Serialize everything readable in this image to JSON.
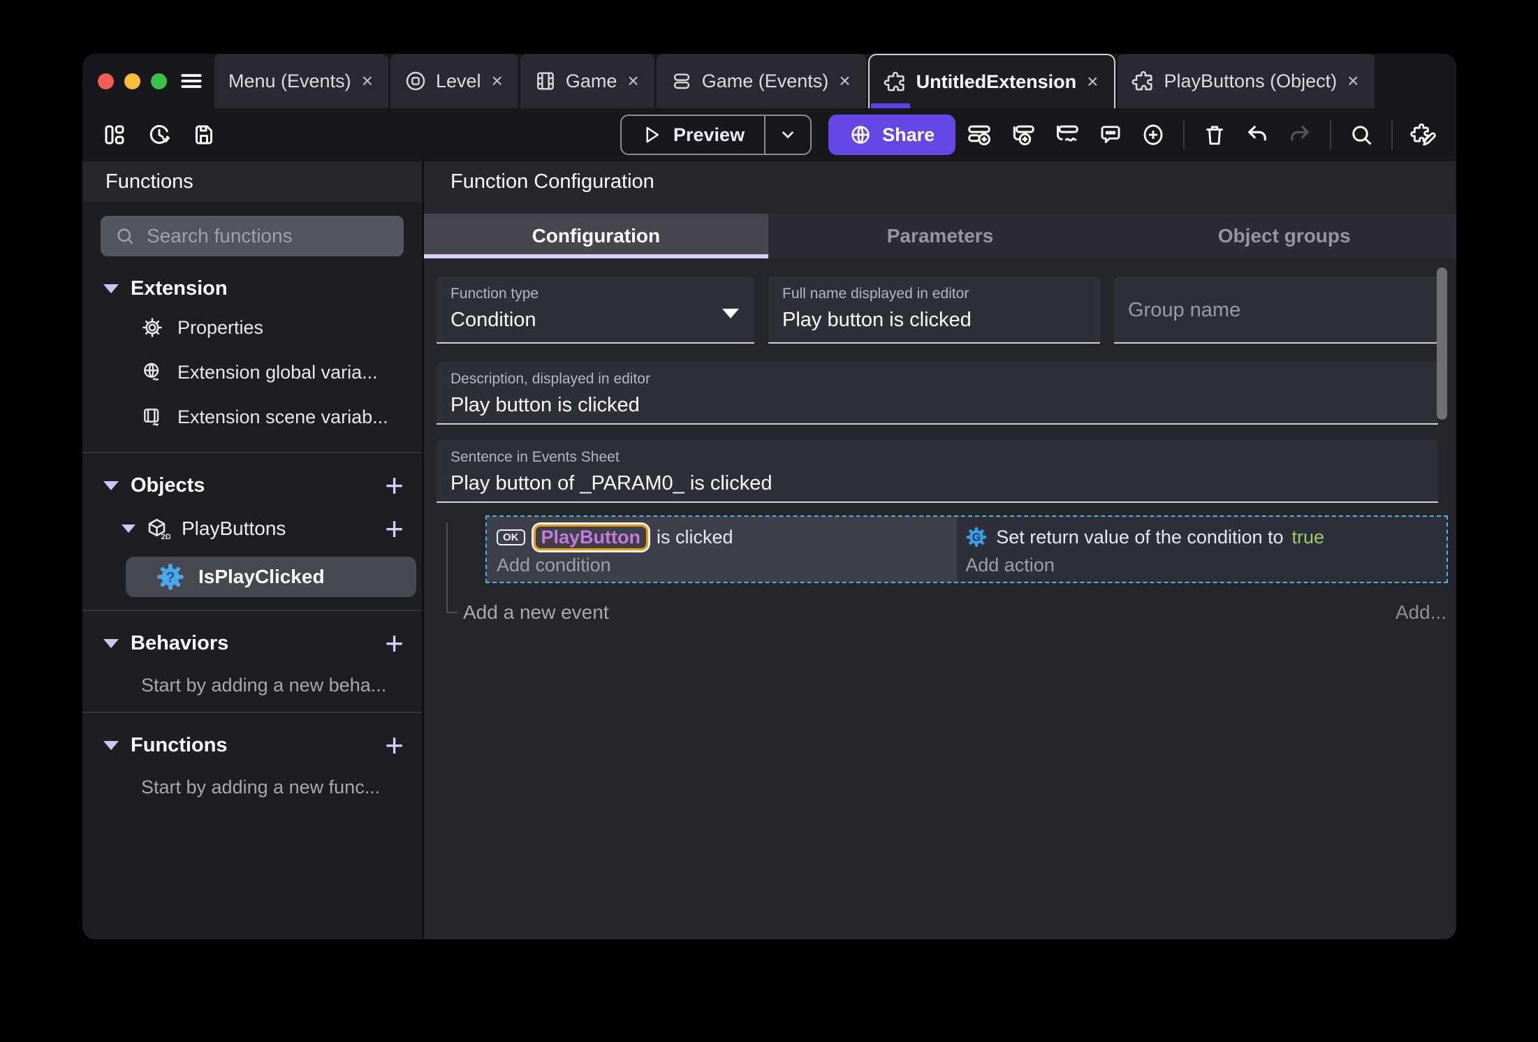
{
  "close_glyph": "×",
  "tabs": [
    {
      "label": "Menu (Events)"
    },
    {
      "label": "Level"
    },
    {
      "label": "Game"
    },
    {
      "label": "Game (Events)"
    },
    {
      "label": "UntitledExtension"
    },
    {
      "label": "PlayButtons (Object)"
    }
  ],
  "toolbar": {
    "preview": "Preview",
    "share": "Share"
  },
  "sidebar": {
    "title": "Functions",
    "search_placeholder": "Search functions",
    "extension": {
      "title": "Extension",
      "items": [
        "Properties",
        "Extension global varia...",
        "Extension scene variab..."
      ]
    },
    "objects": {
      "title": "Objects",
      "group": "PlayButtons",
      "group_icon_label": "2D",
      "selected_item": "IsPlayClicked",
      "selected_icon_glyph": "?"
    },
    "behaviors": {
      "title": "Behaviors",
      "empty_text": "Start by adding a new beha..."
    },
    "functions": {
      "title": "Functions",
      "empty_text": "Start by adding a new func..."
    }
  },
  "main": {
    "title": "Function Configuration",
    "tabs": [
      "Configuration",
      "Parameters",
      "Object groups"
    ],
    "function_type": {
      "label": "Function type",
      "value": "Condition"
    },
    "full_name": {
      "label": "Full name displayed in editor",
      "value": "Play button is clicked"
    },
    "group_name_placeholder": "Group name",
    "description": {
      "label": "Description, displayed in editor",
      "value": "Play button is clicked"
    },
    "sentence": {
      "label": "Sentence in Events Sheet",
      "value": "Play button of _PARAM0_ is clicked"
    },
    "event": {
      "condition_icon_text": "OK",
      "condition_object": "PlayButton",
      "condition_suffix": " is clicked",
      "add_condition": "Add condition",
      "action_icon_letter": "G",
      "action_text": "Set return value of the condition to ",
      "action_value": "true",
      "add_action": "Add action",
      "add_new_event": "Add a new event",
      "add_more": "Add..."
    }
  },
  "colors": {
    "accent_purple": "#6447e4",
    "tab_indicator_purple": "#5f43e6",
    "selection_dashed_blue": "#4fb3e8",
    "object_text_purple": "#c678dd",
    "object_highlight_orange": "#ee9b0b",
    "true_green": "#9ccc65",
    "action_icon_blue": "#3b9de8"
  }
}
